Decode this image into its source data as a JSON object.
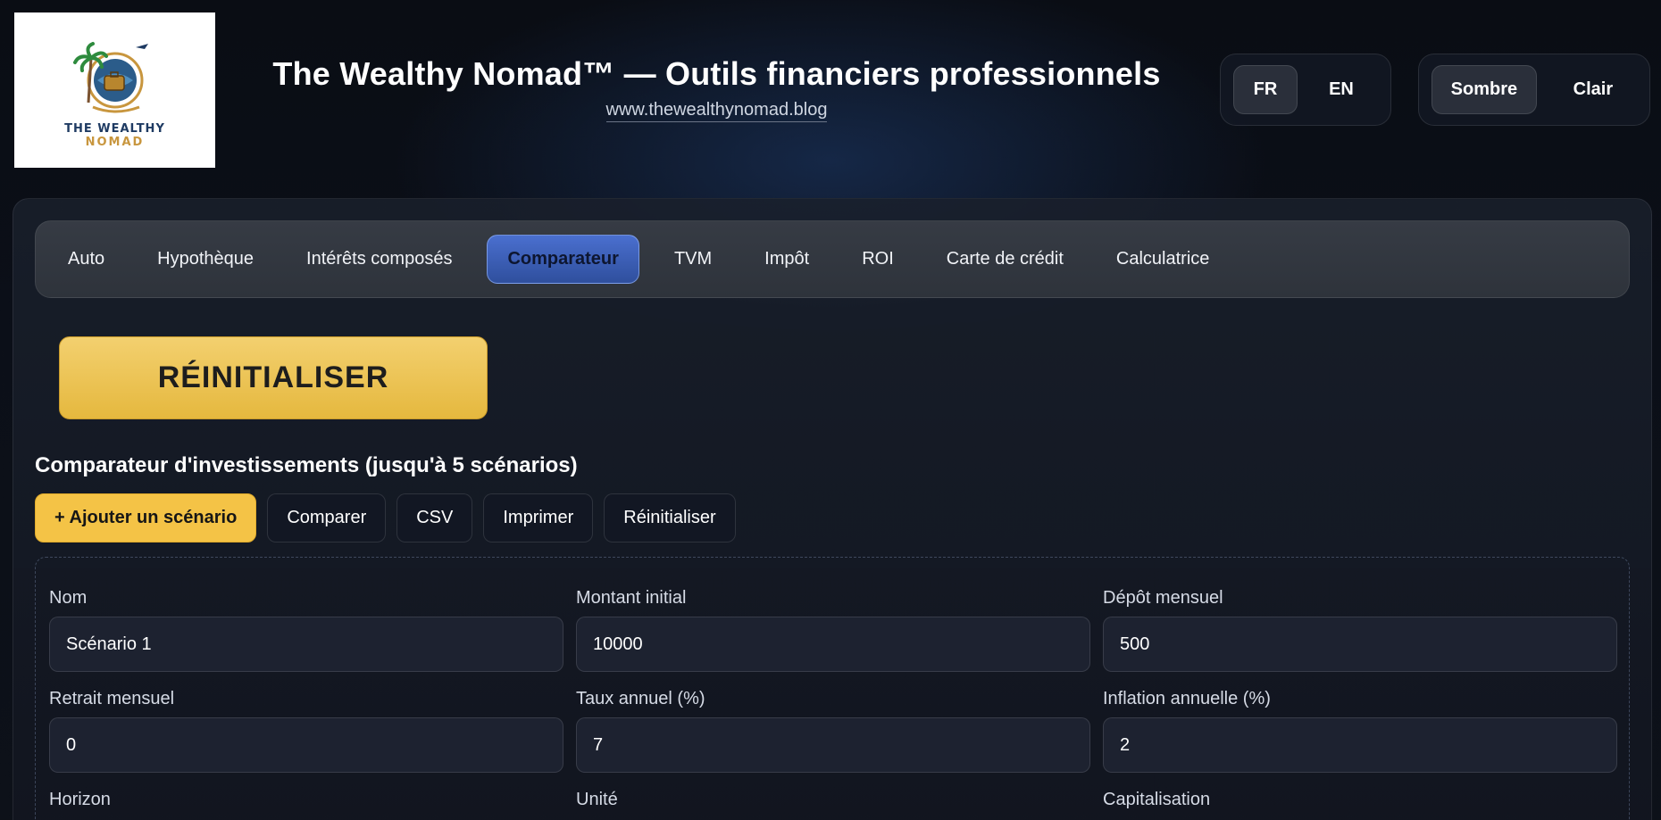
{
  "header": {
    "logo_line1": "THE WEALTHY",
    "logo_line2": "NOMAD",
    "title": "The Wealthy Nomad™ — Outils financiers professionnels",
    "website": "www.thewealthynomad.blog"
  },
  "language_toggle": {
    "fr": "FR",
    "en": "EN",
    "active": "FR"
  },
  "theme_toggle": {
    "dark": "Sombre",
    "light": "Clair",
    "active": "Sombre"
  },
  "tabs": [
    {
      "label": "Auto"
    },
    {
      "label": "Hypothèque"
    },
    {
      "label": "Intérêts composés"
    },
    {
      "label": "Comparateur",
      "active": true
    },
    {
      "label": "TVM"
    },
    {
      "label": "Impôt"
    },
    {
      "label": "ROI"
    },
    {
      "label": "Carte de crédit"
    },
    {
      "label": "Calculatrice"
    }
  ],
  "reset_big_label": "RÉINITIALISER",
  "section_title": "Comparateur d'investissements (jusqu'à 5 scénarios)",
  "actions": {
    "add": "+ Ajouter un scénario",
    "compare": "Comparer",
    "csv": "CSV",
    "print": "Imprimer",
    "reset": "Réinitialiser"
  },
  "form": {
    "name": {
      "label": "Nom",
      "value": "Scénario 1"
    },
    "initial": {
      "label": "Montant initial",
      "value": "10000"
    },
    "monthly_deposit": {
      "label": "Dépôt mensuel",
      "value": "500"
    },
    "monthly_withdrawal": {
      "label": "Retrait mensuel",
      "value": "0"
    },
    "annual_rate": {
      "label": "Taux annuel (%)",
      "value": "7"
    },
    "inflation": {
      "label": "Inflation annuelle (%)",
      "value": "2"
    },
    "horizon": {
      "label": "Horizon",
      "value": ""
    },
    "unit": {
      "label": "Unité",
      "value": ""
    },
    "compounding": {
      "label": "Capitalisation",
      "value": ""
    }
  },
  "colors": {
    "accent_gold": "#f4c346",
    "active_tab": "#3b5fb8",
    "background": "#0b0f18"
  }
}
